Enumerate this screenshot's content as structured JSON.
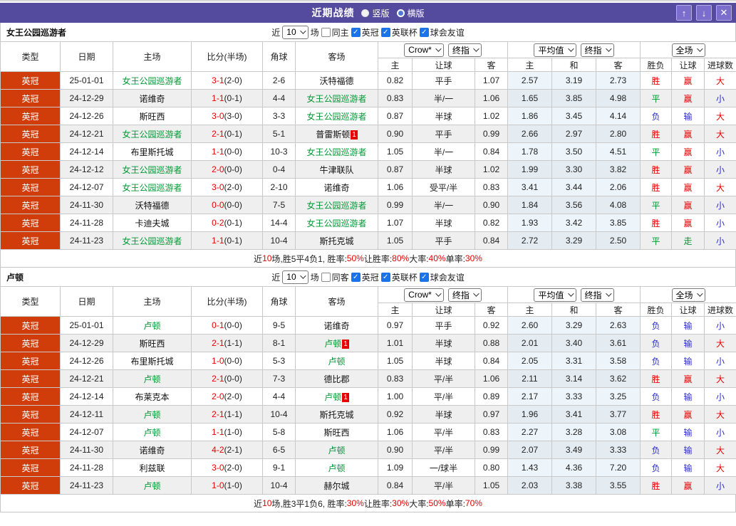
{
  "titlebar": {
    "title": "近期战绩",
    "vertical_label": "竖版",
    "horizontal_label": "横版",
    "vertical_selected": true,
    "up_icon": "↑",
    "down_icon": "↓",
    "close_icon": "✕"
  },
  "palette": {
    "purple": "#544a9e",
    "league_orange": "#d13d0a",
    "red": "#e60000",
    "green": "#009933",
    "blue": "#2b2bd2",
    "check_blue": "#1a73e8",
    "avg_col_bg": "#edf5fb"
  },
  "result_colors": {
    "胜": "red",
    "平": "green",
    "负": "blue",
    "赢": "red",
    "走": "green",
    "输": "blue",
    "大": "red",
    "小": "blue"
  },
  "header": {
    "type": "类型",
    "date": "日期",
    "home": "主场",
    "score": "比分(半场)",
    "corner": "角球",
    "away": "客场",
    "bookmaker_select": "Crow*",
    "stage_select_1": "终指",
    "avg_select": "平均值",
    "stage_select_2": "终指",
    "scope_select": "全场",
    "sub": [
      "主",
      "让球",
      "客",
      "主",
      "和",
      "客",
      "胜负",
      "让球",
      "进球数"
    ]
  },
  "sections": [
    {
      "team": "女王公园巡游者",
      "filter": {
        "near_label": "近",
        "count": "10",
        "games_label": "场",
        "same_label": "同主",
        "same_checked": false,
        "leagues": [
          {
            "label": "英冠",
            "checked": true
          },
          {
            "label": "英联杯",
            "checked": true
          },
          {
            "label": "球会友谊",
            "checked": true
          }
        ]
      },
      "rows": [
        {
          "league": "英冠",
          "date": "25-01-01",
          "home": {
            "name": "女王公园巡游者",
            "focus": true
          },
          "ft": "3-1",
          "ht": "(2-0)",
          "corner": "2-6",
          "away": {
            "name": "沃特福德"
          },
          "odds": [
            "0.82",
            "平手",
            "1.07"
          ],
          "avg": [
            "2.57",
            "3.19",
            "2.73"
          ],
          "res": [
            "胜",
            "赢",
            "大"
          ]
        },
        {
          "league": "英冠",
          "date": "24-12-29",
          "home": {
            "name": "诺维奇"
          },
          "ft": "1-1",
          "ht": "(0-1)",
          "corner": "4-4",
          "away": {
            "name": "女王公园巡游者",
            "focus": true
          },
          "odds": [
            "0.83",
            "半/一",
            "1.06"
          ],
          "avg": [
            "1.65",
            "3.85",
            "4.98"
          ],
          "res": [
            "平",
            "赢",
            "小"
          ]
        },
        {
          "league": "英冠",
          "date": "24-12-26",
          "home": {
            "name": "斯旺西"
          },
          "ft": "3-0",
          "ht": "(3-0)",
          "corner": "3-3",
          "away": {
            "name": "女王公园巡游者",
            "focus": true
          },
          "odds": [
            "0.87",
            "半球",
            "1.02"
          ],
          "avg": [
            "1.86",
            "3.45",
            "4.14"
          ],
          "res": [
            "负",
            "输",
            "大"
          ]
        },
        {
          "league": "英冠",
          "date": "24-12-21",
          "home": {
            "name": "女王公园巡游者",
            "focus": true
          },
          "ft": "2-1",
          "ht": "(0-1)",
          "corner": "5-1",
          "away": {
            "name": "普雷斯顿",
            "badge": "1"
          },
          "odds": [
            "0.90",
            "平手",
            "0.99"
          ],
          "avg": [
            "2.66",
            "2.97",
            "2.80"
          ],
          "res": [
            "胜",
            "赢",
            "大"
          ]
        },
        {
          "league": "英冠",
          "date": "24-12-14",
          "home": {
            "name": "布里斯托城"
          },
          "ft": "1-1",
          "ht": "(0-0)",
          "corner": "10-3",
          "away": {
            "name": "女王公园巡游者",
            "focus": true
          },
          "odds": [
            "1.05",
            "半/一",
            "0.84"
          ],
          "avg": [
            "1.78",
            "3.50",
            "4.51"
          ],
          "res": [
            "平",
            "赢",
            "小"
          ]
        },
        {
          "league": "英冠",
          "date": "24-12-12",
          "home": {
            "name": "女王公园巡游者",
            "focus": true
          },
          "ft": "2-0",
          "ht": "(0-0)",
          "corner": "0-4",
          "away": {
            "name": "牛津联队"
          },
          "odds": [
            "0.87",
            "半球",
            "1.02"
          ],
          "avg": [
            "1.99",
            "3.30",
            "3.82"
          ],
          "res": [
            "胜",
            "赢",
            "小"
          ]
        },
        {
          "league": "英冠",
          "date": "24-12-07",
          "home": {
            "name": "女王公园巡游者",
            "focus": true
          },
          "ft": "3-0",
          "ht": "(2-0)",
          "corner": "2-10",
          "away": {
            "name": "诺维奇"
          },
          "odds": [
            "1.06",
            "受平/半",
            "0.83"
          ],
          "avg": [
            "3.41",
            "3.44",
            "2.06"
          ],
          "res": [
            "胜",
            "赢",
            "大"
          ]
        },
        {
          "league": "英冠",
          "date": "24-11-30",
          "home": {
            "name": "沃特福德"
          },
          "ft": "0-0",
          "ht": "(0-0)",
          "corner": "7-5",
          "away": {
            "name": "女王公园巡游者",
            "focus": true
          },
          "odds": [
            "0.99",
            "半/一",
            "0.90"
          ],
          "avg": [
            "1.84",
            "3.56",
            "4.08"
          ],
          "res": [
            "平",
            "赢",
            "小"
          ]
        },
        {
          "league": "英冠",
          "date": "24-11-28",
          "home": {
            "name": "卡迪夫城"
          },
          "ft": "0-2",
          "ht": "(0-1)",
          "corner": "14-4",
          "away": {
            "name": "女王公园巡游者",
            "focus": true
          },
          "odds": [
            "1.07",
            "半球",
            "0.82"
          ],
          "avg": [
            "1.93",
            "3.42",
            "3.85"
          ],
          "res": [
            "胜",
            "赢",
            "小"
          ]
        },
        {
          "league": "英冠",
          "date": "24-11-23",
          "home": {
            "name": "女王公园巡游者",
            "focus": true
          },
          "ft": "1-1",
          "ht": "(0-1)",
          "corner": "10-4",
          "away": {
            "name": "斯托克城"
          },
          "odds": [
            "1.05",
            "平手",
            "0.84"
          ],
          "avg": [
            "2.72",
            "3.29",
            "2.50"
          ],
          "res": [
            "平",
            "走",
            "小"
          ]
        }
      ],
      "summary": [
        {
          "t": "近"
        },
        {
          "t": "10",
          "hl": true
        },
        {
          "t": "场,胜5平4负1, 胜率:"
        },
        {
          "t": "50%",
          "hl": true
        },
        {
          "t": " 让胜率:"
        },
        {
          "t": "80%",
          "hl": true
        },
        {
          "t": " 大率:"
        },
        {
          "t": "40%",
          "hl": true
        },
        {
          "t": " 单率:"
        },
        {
          "t": "30%",
          "hl": true
        }
      ]
    },
    {
      "team": "卢顿",
      "filter": {
        "near_label": "近",
        "count": "10",
        "games_label": "场",
        "same_label": "同客",
        "same_checked": false,
        "leagues": [
          {
            "label": "英冠",
            "checked": true
          },
          {
            "label": "英联杯",
            "checked": true
          },
          {
            "label": "球会友谊",
            "checked": true
          }
        ]
      },
      "rows": [
        {
          "league": "英冠",
          "date": "25-01-01",
          "home": {
            "name": "卢顿",
            "focus": true
          },
          "ft": "0-1",
          "ht": "(0-0)",
          "corner": "9-5",
          "away": {
            "name": "诺维奇"
          },
          "odds": [
            "0.97",
            "平手",
            "0.92"
          ],
          "avg": [
            "2.60",
            "3.29",
            "2.63"
          ],
          "res": [
            "负",
            "输",
            "小"
          ]
        },
        {
          "league": "英冠",
          "date": "24-12-29",
          "home": {
            "name": "斯旺西"
          },
          "ft": "2-1",
          "ht": "(1-1)",
          "corner": "8-1",
          "away": {
            "name": "卢顿",
            "focus": true,
            "badge": "1"
          },
          "odds": [
            "1.01",
            "半球",
            "0.88"
          ],
          "avg": [
            "2.01",
            "3.40",
            "3.61"
          ],
          "res": [
            "负",
            "输",
            "大"
          ]
        },
        {
          "league": "英冠",
          "date": "24-12-26",
          "home": {
            "name": "布里斯托城"
          },
          "ft": "1-0",
          "ht": "(0-0)",
          "corner": "5-3",
          "away": {
            "name": "卢顿",
            "focus": true
          },
          "odds": [
            "1.05",
            "半球",
            "0.84"
          ],
          "avg": [
            "2.05",
            "3.31",
            "3.58"
          ],
          "res": [
            "负",
            "输",
            "小"
          ]
        },
        {
          "league": "英冠",
          "date": "24-12-21",
          "home": {
            "name": "卢顿",
            "focus": true
          },
          "ft": "2-1",
          "ht": "(0-0)",
          "corner": "7-3",
          "away": {
            "name": "德比郡"
          },
          "odds": [
            "0.83",
            "平/半",
            "1.06"
          ],
          "avg": [
            "2.11",
            "3.14",
            "3.62"
          ],
          "res": [
            "胜",
            "赢",
            "大"
          ]
        },
        {
          "league": "英冠",
          "date": "24-12-14",
          "home": {
            "name": "布莱克本"
          },
          "ft": "2-0",
          "ht": "(2-0)",
          "corner": "4-4",
          "away": {
            "name": "卢顿",
            "focus": true,
            "badge": "1"
          },
          "odds": [
            "1.00",
            "平/半",
            "0.89"
          ],
          "avg": [
            "2.17",
            "3.33",
            "3.25"
          ],
          "res": [
            "负",
            "输",
            "小"
          ]
        },
        {
          "league": "英冠",
          "date": "24-12-11",
          "home": {
            "name": "卢顿",
            "focus": true
          },
          "ft": "2-1",
          "ht": "(1-1)",
          "corner": "10-4",
          "away": {
            "name": "斯托克城"
          },
          "odds": [
            "0.92",
            "半球",
            "0.97"
          ],
          "avg": [
            "1.96",
            "3.41",
            "3.77"
          ],
          "res": [
            "胜",
            "赢",
            "大"
          ]
        },
        {
          "league": "英冠",
          "date": "24-12-07",
          "home": {
            "name": "卢顿",
            "focus": true
          },
          "ft": "1-1",
          "ht": "(1-0)",
          "corner": "5-8",
          "away": {
            "name": "斯旺西"
          },
          "odds": [
            "1.06",
            "平/半",
            "0.83"
          ],
          "avg": [
            "2.27",
            "3.28",
            "3.08"
          ],
          "res": [
            "平",
            "输",
            "小"
          ]
        },
        {
          "league": "英冠",
          "date": "24-11-30",
          "home": {
            "name": "诺维奇"
          },
          "ft": "4-2",
          "ht": "(2-1)",
          "corner": "6-5",
          "away": {
            "name": "卢顿",
            "focus": true
          },
          "odds": [
            "0.90",
            "平/半",
            "0.99"
          ],
          "avg": [
            "2.07",
            "3.49",
            "3.33"
          ],
          "res": [
            "负",
            "输",
            "大"
          ]
        },
        {
          "league": "英冠",
          "date": "24-11-28",
          "home": {
            "name": "利兹联"
          },
          "ft": "3-0",
          "ht": "(2-0)",
          "corner": "9-1",
          "away": {
            "name": "卢顿",
            "focus": true
          },
          "odds": [
            "1.09",
            "一/球半",
            "0.80"
          ],
          "avg": [
            "1.43",
            "4.36",
            "7.20"
          ],
          "res": [
            "负",
            "输",
            "大"
          ]
        },
        {
          "league": "英冠",
          "date": "24-11-23",
          "home": {
            "name": "卢顿",
            "focus": true
          },
          "ft": "1-0",
          "ht": "(1-0)",
          "corner": "10-4",
          "away": {
            "name": "赫尔城"
          },
          "odds": [
            "0.84",
            "平/半",
            "1.05"
          ],
          "avg": [
            "2.03",
            "3.38",
            "3.55"
          ],
          "res": [
            "胜",
            "赢",
            "小"
          ]
        }
      ],
      "summary": [
        {
          "t": "近"
        },
        {
          "t": "10",
          "hl": true
        },
        {
          "t": "场,胜3平1负6, 胜率:"
        },
        {
          "t": "30%",
          "hl": true
        },
        {
          "t": " 让胜率:"
        },
        {
          "t": "30%",
          "hl": true
        },
        {
          "t": " 大率:"
        },
        {
          "t": "50%",
          "hl": true
        },
        {
          "t": " 单率:"
        },
        {
          "t": "70%",
          "hl": true
        }
      ]
    }
  ]
}
